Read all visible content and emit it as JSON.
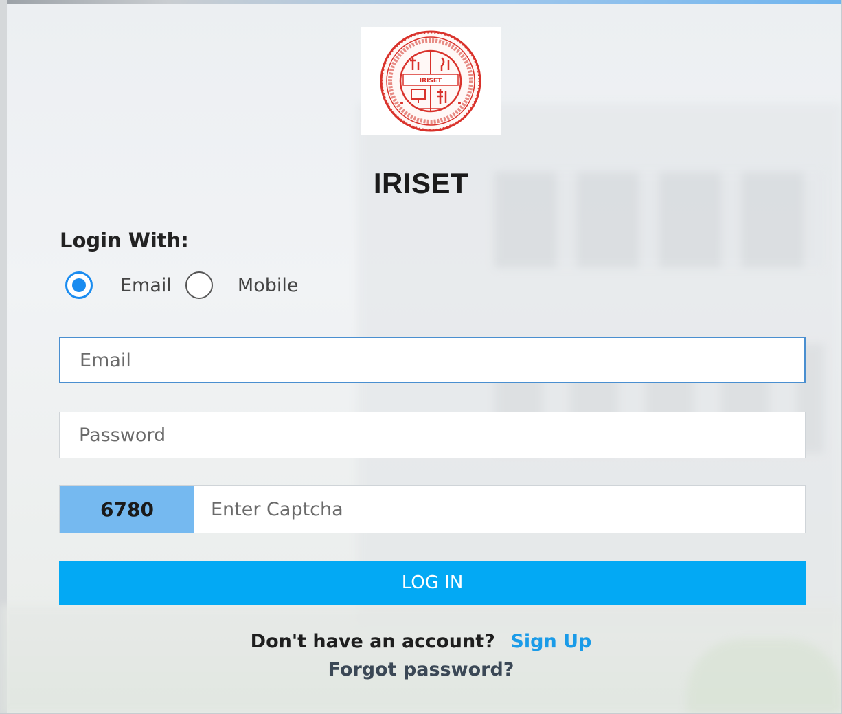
{
  "brand": {
    "logo_icon": "iriset-emblem-icon",
    "logo_text": "IRISET",
    "title": "IRISET"
  },
  "login_with": {
    "label": "Login With:",
    "options": [
      {
        "label": "Email",
        "selected": true
      },
      {
        "label": "Mobile",
        "selected": false
      }
    ]
  },
  "form": {
    "email_placeholder": "Email",
    "password_placeholder": "Password",
    "captcha_code": "6780",
    "captcha_placeholder": "Enter Captcha",
    "login_button": "LOG IN"
  },
  "footer": {
    "no_account_text": "Don't have an account?",
    "signup_link": "Sign Up",
    "forgot_link": "Forgot password?"
  },
  "colors": {
    "primary_button": "#03a9f4",
    "captcha_bg": "#75b9f0",
    "link": "#1a9be8",
    "radio_active": "#1a8cf0",
    "logo_red": "#d9322b"
  }
}
